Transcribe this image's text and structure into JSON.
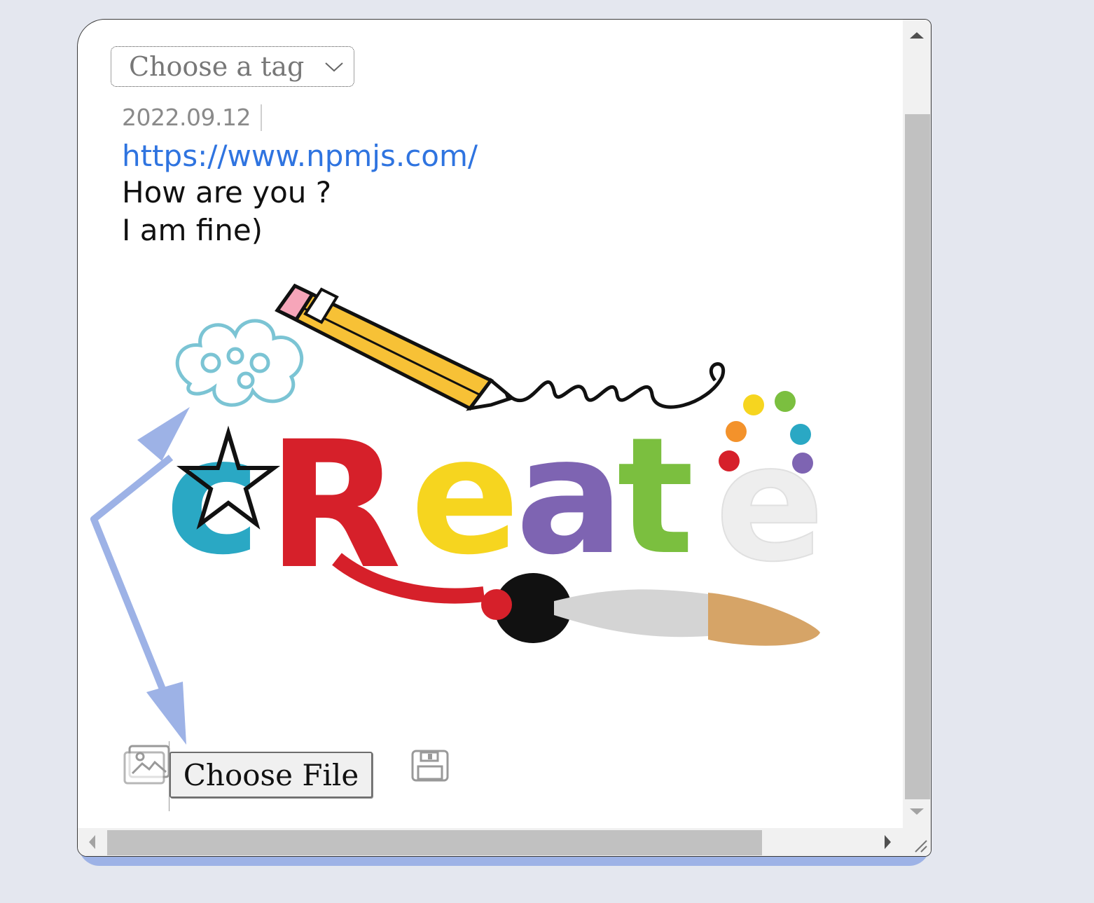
{
  "tag_select": {
    "placeholder": "Choose a tag",
    "icon": "chevron-down-icon"
  },
  "post": {
    "date": "2022.09.12",
    "link": "https://www.npmjs.com/",
    "lines": [
      "How are you ?",
      "I am fine)"
    ]
  },
  "image": {
    "word": "create"
  },
  "toolbar": {
    "image_icon": "image-icon",
    "file_button": "Choose File",
    "save_icon": "floppy-disk-icon"
  },
  "colors": {
    "link": "#2f74e0",
    "arrow": "#9db2e6",
    "card_shadow": "#9db2e6",
    "page_bg": "#e4e7ef"
  }
}
